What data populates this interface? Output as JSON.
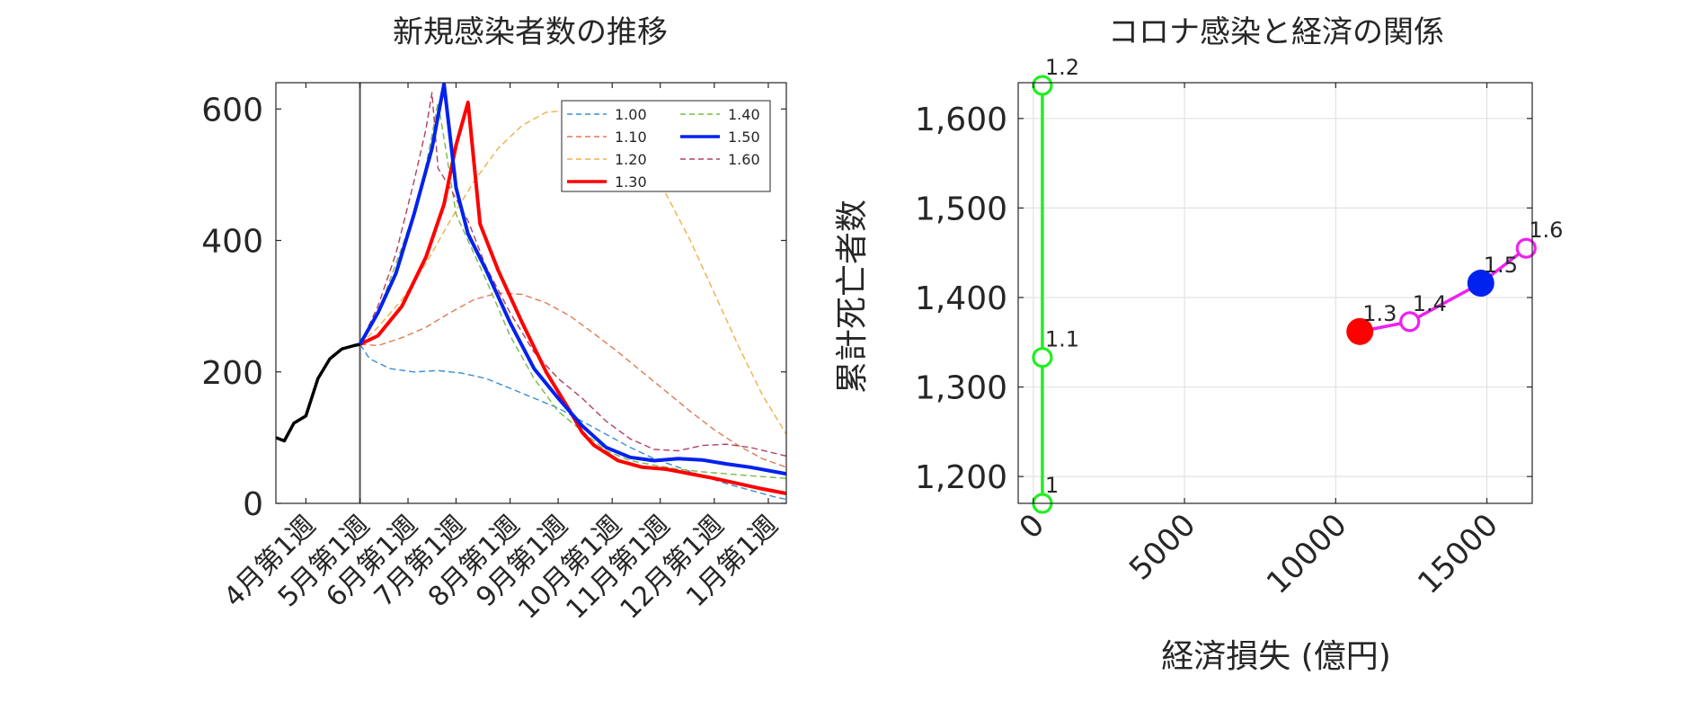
{
  "chart_data": [
    {
      "type": "line",
      "title": "新規感染者数の推移",
      "xlabel": "",
      "ylabel": "",
      "x_range": [
        -2.5,
        40
      ],
      "ylim": [
        0,
        640
      ],
      "yticks": [
        0,
        200,
        400,
        600
      ],
      "xtick_positions": [
        0,
        4.5,
        8.5,
        12.5,
        17,
        21,
        25.5,
        29.5,
        34,
        38.5
      ],
      "xtick_labels": [
        "4月第1週",
        "5月第1週",
        "6月第1週",
        "7月第1週",
        "8月第1週",
        "9月第1週",
        "10月第1週",
        "11月第1週",
        "12月第1週",
        "1月第1週"
      ],
      "vertical_marker_x": 4.5,
      "grid": false,
      "legend_position": "top-right",
      "series": [
        {
          "name": "",
          "color": "#000000",
          "style": "solid",
          "width": 3.5,
          "x": [
            -2.5,
            -1.8,
            -1,
            0,
            1,
            2,
            3,
            4,
            4.5
          ],
          "y": [
            100,
            95,
            122,
            133,
            190,
            220,
            235,
            240,
            242
          ]
        },
        {
          "name": "1.00",
          "color": "#3a8fd0",
          "style": "dashed",
          "width": 1.4,
          "x": [
            4.5,
            5.3,
            7,
            9,
            11,
            13,
            15,
            17,
            19,
            21,
            23,
            25,
            27,
            29,
            31,
            33,
            35,
            37,
            39,
            40
          ],
          "y": [
            242,
            220,
            205,
            200,
            202,
            198,
            190,
            175,
            160,
            145,
            125,
            105,
            85,
            68,
            55,
            42,
            30,
            20,
            10,
            6
          ]
        },
        {
          "name": "1.10",
          "color": "#e07a55",
          "style": "dashed",
          "width": 1.4,
          "x": [
            4.5,
            6,
            8,
            10,
            12,
            14,
            16,
            18,
            20,
            22,
            24,
            26,
            28,
            30,
            32,
            34,
            36,
            38,
            40
          ],
          "y": [
            242,
            240,
            252,
            268,
            290,
            310,
            320,
            318,
            305,
            285,
            258,
            230,
            200,
            170,
            140,
            112,
            88,
            68,
            55
          ]
        },
        {
          "name": "1.20",
          "color": "#eeb14a",
          "style": "dashed",
          "width": 1.4,
          "x": [
            4.5,
            6,
            8,
            10,
            12,
            14,
            16,
            18,
            20,
            22,
            24,
            26,
            28,
            30,
            32,
            34,
            36,
            38,
            40
          ],
          "y": [
            242,
            268,
            310,
            365,
            430,
            490,
            540,
            575,
            595,
            598,
            585,
            560,
            520,
            470,
            400,
            320,
            240,
            165,
            105
          ]
        },
        {
          "name": "1.30",
          "color": "#ff0000",
          "style": "solid",
          "width": 4,
          "x": [
            4.5,
            6,
            8,
            10,
            11.5,
            12.5,
            13.5,
            14.5,
            16,
            18,
            20,
            22,
            23,
            24,
            26,
            28,
            30,
            32,
            34,
            36,
            38,
            40
          ],
          "y": [
            242,
            255,
            300,
            375,
            455,
            545,
            610,
            425,
            355,
            275,
            200,
            140,
            108,
            88,
            65,
            55,
            52,
            45,
            38,
            30,
            22,
            15
          ]
        },
        {
          "name": "1.40",
          "color": "#77bb44",
          "style": "dashed",
          "width": 1.4,
          "x": [
            4.5,
            6,
            8,
            9.5,
            10.5,
            11,
            11.5,
            12.5,
            13.5,
            15,
            17,
            19,
            21,
            23,
            25,
            27,
            29,
            31,
            33,
            35,
            37,
            40
          ],
          "y": [
            242,
            290,
            390,
            470,
            560,
            610,
            555,
            440,
            400,
            340,
            255,
            190,
            140,
            110,
            80,
            65,
            58,
            52,
            48,
            45,
            42,
            38
          ]
        },
        {
          "name": "1.50",
          "color": "#0022ee",
          "style": "solid",
          "width": 4,
          "x": [
            4.5,
            6,
            7.5,
            9,
            10.5,
            11.5,
            12.5,
            13.5,
            15,
            17,
            19,
            21,
            23,
            25,
            27,
            29,
            31,
            33,
            35,
            37,
            40
          ],
          "y": [
            242,
            290,
            350,
            440,
            540,
            638,
            480,
            410,
            355,
            275,
            205,
            160,
            118,
            85,
            70,
            65,
            68,
            66,
            60,
            55,
            45
          ]
        },
        {
          "name": "1.60",
          "color": "#b04060",
          "style": "dashed",
          "width": 1.4,
          "x": [
            4.5,
            6,
            7.5,
            9,
            10,
            10.5,
            11,
            12,
            13.5,
            15,
            17,
            19,
            21,
            23,
            25,
            27,
            29,
            31,
            33,
            35,
            37,
            40
          ],
          "y": [
            242,
            300,
            380,
            490,
            570,
            625,
            510,
            480,
            430,
            360,
            290,
            230,
            190,
            160,
            125,
            98,
            82,
            80,
            88,
            90,
            85,
            72
          ]
        }
      ]
    },
    {
      "type": "scatter",
      "title": "コロナ感染と経済の関係",
      "xlabel": "経済損失 (億円)",
      "ylabel": "累計死亡者数",
      "xlim": [
        -500,
        16500
      ],
      "ylim": [
        1170,
        1640
      ],
      "xticks": [
        0,
        5000,
        10000,
        15000
      ],
      "xtick_labels": [
        "0",
        "5000",
        "10000",
        "15000"
      ],
      "yticks": [
        1200,
        1300,
        1400,
        1500,
        1600
      ],
      "ytick_labels": [
        "1,200",
        "1,300",
        "1,400",
        "1,500",
        "1,600"
      ],
      "grid": true,
      "series": [
        {
          "name": "",
          "color": "#22ee22",
          "x": [
            300,
            300,
            300
          ],
          "y": [
            1170,
            1333,
            1637
          ],
          "labels": [
            "1",
            "1.1",
            "1.2"
          ],
          "filled": [
            false,
            false,
            false
          ]
        },
        {
          "name": "",
          "color": "#ee22ee",
          "x": [
            10800,
            12450,
            14800,
            16300
          ],
          "y": [
            1362,
            1373,
            1416,
            1455
          ],
          "labels": [
            "1.3",
            "1.4",
            "1.5",
            "1.6"
          ],
          "marker_colors": [
            "#ff0000",
            "#ee22ee",
            "#0022ee",
            "#ee22ee"
          ],
          "filled": [
            true,
            false,
            true,
            false
          ]
        }
      ]
    }
  ]
}
